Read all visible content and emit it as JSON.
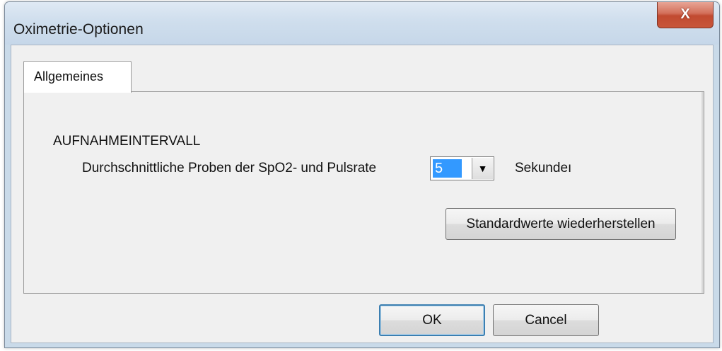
{
  "window": {
    "title": "Oximetrie-Optionen",
    "close_label": "X"
  },
  "tabs": [
    {
      "label": "Allgemeines",
      "selected": true
    }
  ],
  "group": {
    "label": "AUFNAHMEINTERVALL"
  },
  "sampling": {
    "label": "Durchschnittliche Proben der SpO2- und Pulsrate",
    "value": "5",
    "dropdown_arrow": "▼",
    "unit": "Sekundeı"
  },
  "buttons": {
    "restore_label": "Standardwerte wiederherstellen",
    "ok_label": "OK",
    "cancel_label": "Cancel"
  },
  "colors": {
    "selection": "#3399ff",
    "close_button": "#c8563a",
    "default_button_border": "#3c7fb1"
  }
}
